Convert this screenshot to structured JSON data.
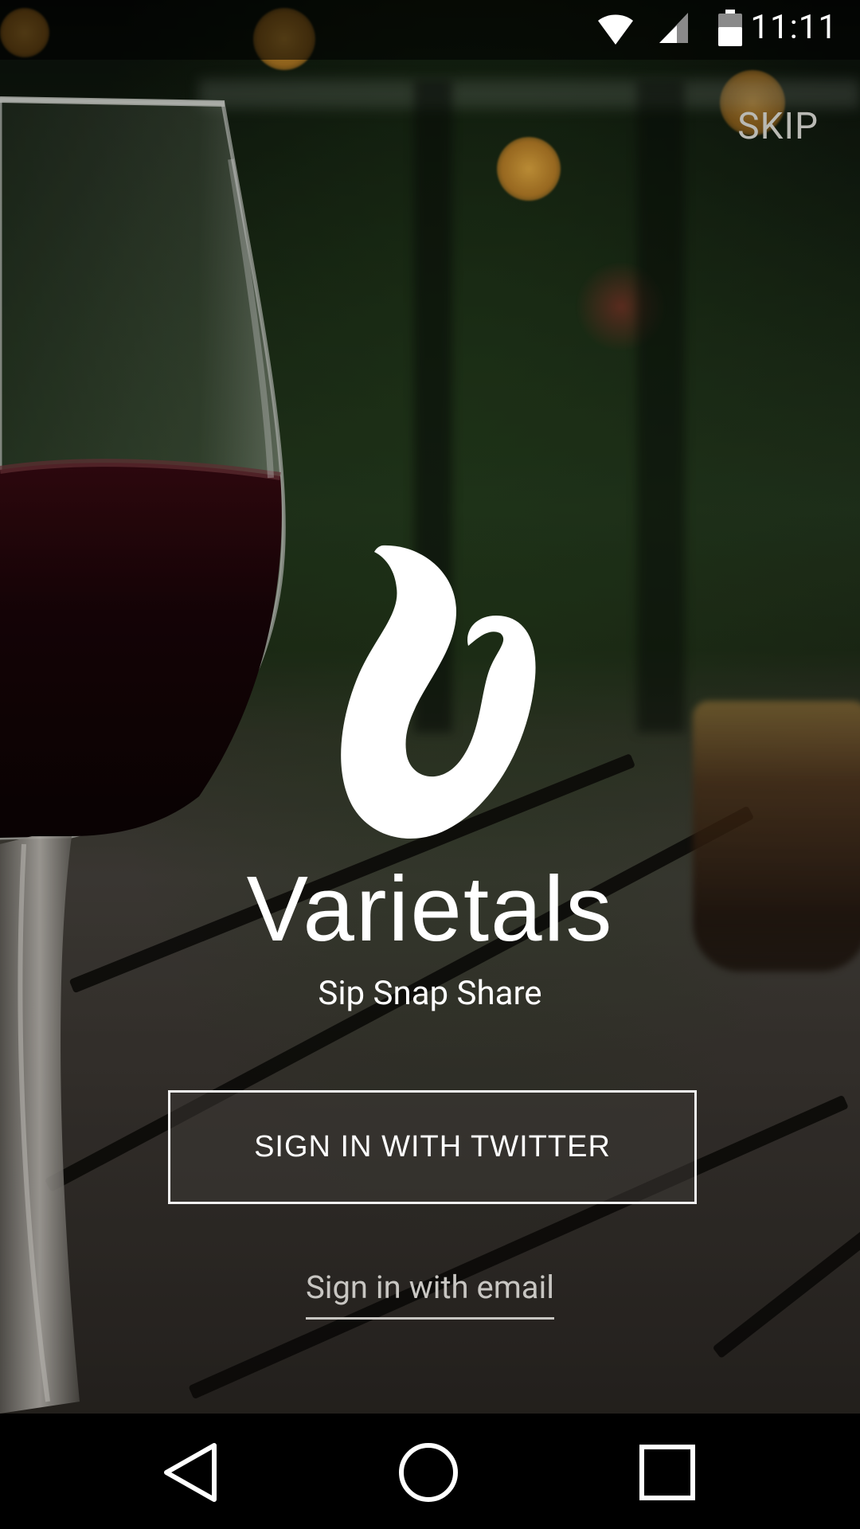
{
  "status_bar": {
    "time": "11:11",
    "icons": [
      "wifi-icon",
      "cellular-signal-icon",
      "battery-icon"
    ]
  },
  "skip_label": "SKIP",
  "app": {
    "title": "Varietals",
    "tagline": "Sip Snap Share"
  },
  "actions": {
    "twitter_label": "SIGN IN WITH TWITTER",
    "email_label": "Sign in with email"
  },
  "nav_bar": {
    "icons": [
      "back-icon",
      "home-icon",
      "recents-icon"
    ]
  },
  "colors": {
    "text": "#ffffff",
    "muted_text": "#c8c6c2",
    "skip_text": "#b9b9b4",
    "nav_bar": "#000000"
  }
}
